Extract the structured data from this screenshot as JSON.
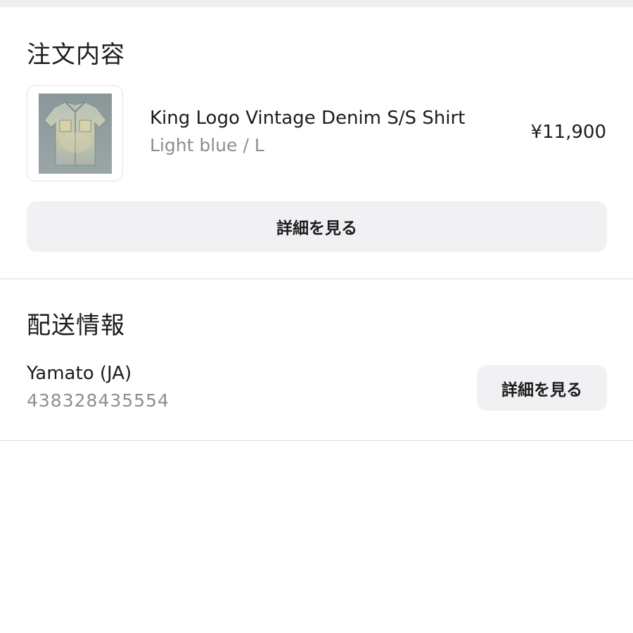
{
  "order_section": {
    "title": "注文内容",
    "product": {
      "name": "King Logo Vintage Denim S/S Shirt",
      "variant": "Light blue / L",
      "price": "¥11,900",
      "thumbnail_icon": "denim-shirt-photo"
    },
    "details_button_label": "詳細を見る"
  },
  "shipping_section": {
    "title": "配送情報",
    "carrier": "Yamato (JA)",
    "tracking_number": "438328435554",
    "details_button_label": "詳細を見る"
  },
  "colors": {
    "background": "#ffffff",
    "button_bg": "#f1f1f3",
    "secondary_text": "#8e8e93",
    "divider": "#dcdcdf"
  }
}
